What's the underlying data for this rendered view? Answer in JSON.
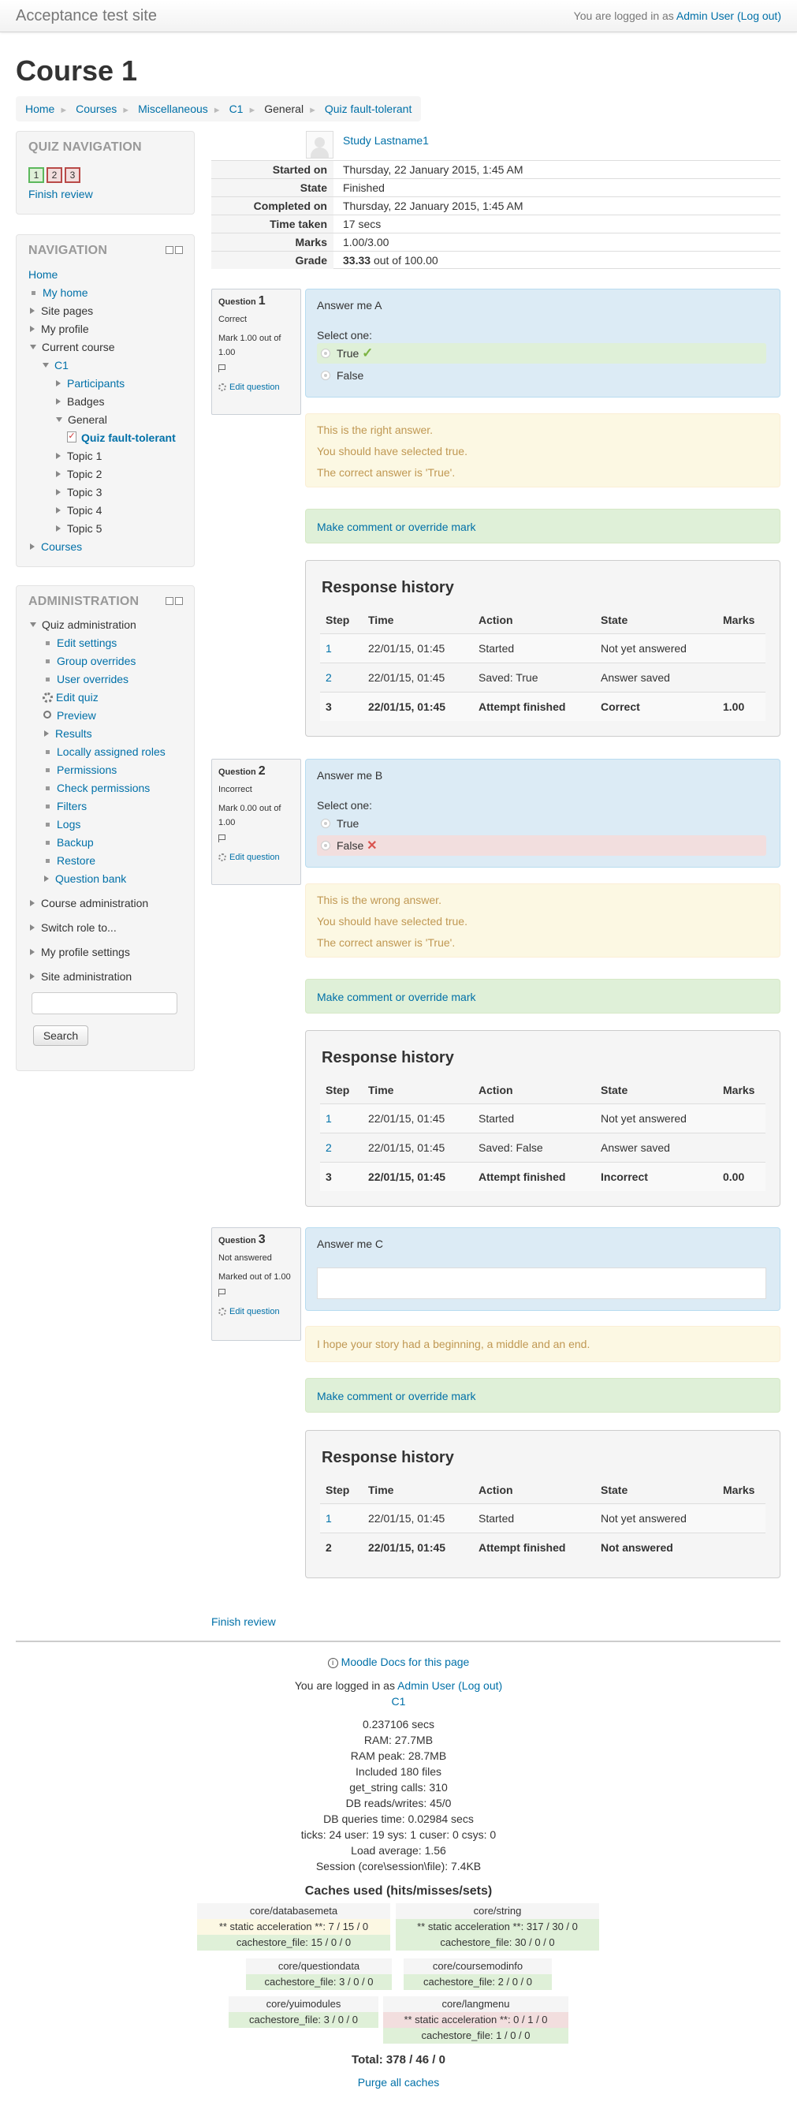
{
  "header": {
    "site_name": "Acceptance test site",
    "login_prefix": "You are logged in as",
    "user": "Admin User",
    "logout": "(Log out)"
  },
  "course_title": "Course 1",
  "breadcrumb": [
    "Home",
    "Courses",
    "Miscellaneous",
    "C1",
    "General",
    "Quiz fault-tolerant"
  ],
  "quiz_nav": {
    "title": "QUIZ NAVIGATION",
    "buttons": [
      "1",
      "2",
      "3"
    ],
    "finish": "Finish review"
  },
  "navigation": {
    "title": "NAVIGATION",
    "items": [
      "Home",
      "My home",
      "Site pages",
      "My profile",
      "Current course",
      "C1",
      "Participants",
      "Badges",
      "General",
      "Quiz fault-tolerant",
      "Topic 1",
      "Topic 2",
      "Topic 3",
      "Topic 4",
      "Topic 5",
      "Courses"
    ]
  },
  "administration": {
    "title": "ADMINISTRATION",
    "items": [
      "Quiz administration",
      "Edit settings",
      "Group overrides",
      "User overrides",
      "Edit quiz",
      "Preview",
      "Results",
      "Locally assigned roles",
      "Permissions",
      "Check permissions",
      "Filters",
      "Logs",
      "Backup",
      "Restore",
      "Question bank",
      "Course administration",
      "Switch role to...",
      "My profile settings",
      "Site administration"
    ],
    "search_button": "Search"
  },
  "summary": {
    "user": "Study Lastname1",
    "rows": [
      {
        "label": "Started on",
        "value": "Thursday, 22 January 2015, 1:45 AM"
      },
      {
        "label": "State",
        "value": "Finished"
      },
      {
        "label": "Completed on",
        "value": "Thursday, 22 January 2015, 1:45 AM"
      },
      {
        "label": "Time taken",
        "value": "17 secs"
      },
      {
        "label": "Marks",
        "value": "1.00/3.00"
      }
    ],
    "grade_label": "Grade",
    "grade_value": "33.33",
    "grade_suffix": "out of 100.00"
  },
  "questions": [
    {
      "number": "1",
      "status": "Correct",
      "mark": "Mark 1.00 out of 1.00",
      "edit": "Edit question",
      "text": "Answer me A",
      "select": "Select one:",
      "options": [
        "True",
        "False"
      ],
      "feedback": [
        "This is the right answer.",
        "You should have selected true.",
        "The correct answer is 'True'."
      ],
      "comment": "Make comment or override mark",
      "history": [
        [
          "1",
          "22/01/15, 01:45",
          "Started",
          "Not yet answered",
          ""
        ],
        [
          "2",
          "22/01/15, 01:45",
          "Saved: True",
          "Answer saved",
          ""
        ],
        [
          "3",
          "22/01/15, 01:45",
          "Attempt finished",
          "Correct",
          "1.00"
        ]
      ]
    },
    {
      "number": "2",
      "status": "Incorrect",
      "mark": "Mark 0.00 out of 1.00",
      "edit": "Edit question",
      "text": "Answer me B",
      "select": "Select one:",
      "options": [
        "True",
        "False"
      ],
      "feedback": [
        "This is the wrong answer.",
        "You should have selected true.",
        "The correct answer is 'True'."
      ],
      "comment": "Make comment or override mark",
      "history": [
        [
          "1",
          "22/01/15, 01:45",
          "Started",
          "Not yet answered",
          ""
        ],
        [
          "2",
          "22/01/15, 01:45",
          "Saved: False",
          "Answer saved",
          ""
        ],
        [
          "3",
          "22/01/15, 01:45",
          "Attempt finished",
          "Incorrect",
          "0.00"
        ]
      ]
    },
    {
      "number": "3",
      "status": "Not answered",
      "mark": "Marked out of 1.00",
      "edit": "Edit question",
      "text": "Answer me C",
      "feedback": [
        "I hope your story had a beginning, a middle and an end."
      ],
      "comment": "Make comment or override mark",
      "history": [
        [
          "1",
          "22/01/15, 01:45",
          "Started",
          "Not yet answered",
          ""
        ],
        [
          "2",
          "22/01/15, 01:45",
          "Attempt finished",
          "Not answered",
          ""
        ]
      ]
    }
  ],
  "history_title": "Response history",
  "history_headers": [
    "Step",
    "Time",
    "Action",
    "State",
    "Marks"
  ],
  "question_label": "Question",
  "finish_review": "Finish review",
  "footer": {
    "docs": "Moodle Docs for this page",
    "login_prefix": "You are logged in as",
    "user": "Admin User",
    "logout": "(Log out)",
    "course": "C1",
    "stats": [
      "0.237106 secs",
      "RAM: 27.7MB",
      "RAM peak: 28.7MB",
      "Included 180 files",
      "get_string calls: 310",
      "DB reads/writes: 45/0",
      "DB queries time: 0.02984 secs",
      "ticks: 24 user: 19 sys: 1 cuser: 0 csys: 0",
      "Load average: 1.56",
      "Session (core\\session\\file): 7.4KB"
    ],
    "caches_title": "Caches used (hits/misses/sets)",
    "caches": [
      {
        "name": "core/databasemeta",
        "lines": [
          "** static acceleration **: 7 / 15 / 0",
          "cachestore_file: 15 / 0 / 0"
        ]
      },
      {
        "name": "core/string",
        "lines": [
          "** static acceleration **: 317 / 30 / 0",
          "cachestore_file: 30 / 0 / 0"
        ]
      },
      {
        "name": "core/questiondata",
        "lines": [
          "cachestore_file: 3 / 0 / 0"
        ]
      },
      {
        "name": "core/coursemodinfo",
        "lines": [
          "cachestore_file: 2 / 0 / 0"
        ]
      },
      {
        "name": "core/yuimodules",
        "lines": [
          "cachestore_file: 3 / 0 / 0"
        ]
      },
      {
        "name": "core/langmenu",
        "lines": [
          "** static acceleration **: 0 / 1 / 0",
          "cachestore_file: 1 / 0 / 0"
        ]
      }
    ],
    "total": "Total: 378 / 46 / 0",
    "purge": "Purge all caches"
  },
  "colors": {
    "link": "#0070a8",
    "correct": "#8bc34a",
    "incorrect": "#d9534f"
  }
}
